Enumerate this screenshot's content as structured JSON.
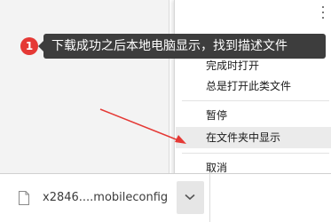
{
  "context_menu": {
    "items": [
      {
        "label": "完成时打开"
      },
      {
        "label": "总是打开此类文件"
      },
      {
        "label": "暂停"
      },
      {
        "label": "在文件夹中显示"
      },
      {
        "label": "取消"
      }
    ]
  },
  "annotation": {
    "step_number": "1",
    "text": "下载成功之后本地电脑显示，找到描述文件",
    "badge_color": "#e53935",
    "arrow_color": "#e53935"
  },
  "download_bar": {
    "file_name": "x2846....mobileconfig",
    "file_icon": "file-icon",
    "menu_icon": "chevron-down-icon"
  }
}
